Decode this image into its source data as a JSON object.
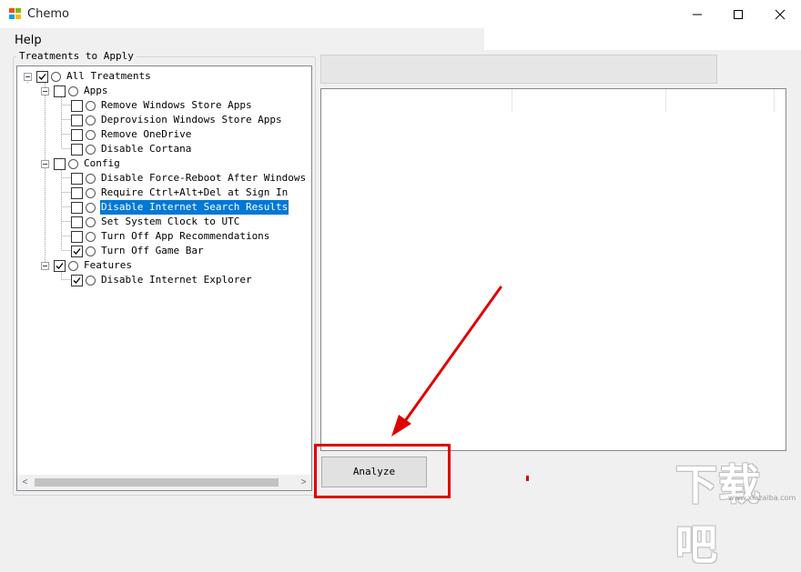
{
  "window": {
    "title": "Chemo",
    "controls": {
      "minimize": "—",
      "maximize": "☐",
      "close": "✕"
    }
  },
  "menu": {
    "help": "Help"
  },
  "treatments": {
    "group_title": "Treatments to Apply",
    "root": {
      "label": "All Treatments",
      "checked": true
    },
    "groups": [
      {
        "label": "Apps",
        "checked": false,
        "items": [
          {
            "label": "Remove Windows Store Apps",
            "checked": false
          },
          {
            "label": "Deprovision Windows Store Apps",
            "checked": false
          },
          {
            "label": "Remove OneDrive",
            "checked": false
          },
          {
            "label": "Disable Cortana",
            "checked": false
          }
        ]
      },
      {
        "label": "Config",
        "checked": false,
        "items": [
          {
            "label": "Disable Force-Reboot After Windows Upd",
            "checked": false
          },
          {
            "label": "Require Ctrl+Alt+Del at Sign In",
            "checked": false
          },
          {
            "label": "Disable Internet Search Results",
            "checked": false,
            "selected": true
          },
          {
            "label": "Set System Clock to UTC",
            "checked": false
          },
          {
            "label": "Turn Off App Recommendations",
            "checked": false
          },
          {
            "label": "Turn Off Game Bar",
            "checked": true
          }
        ]
      },
      {
        "label": "Features",
        "checked": true,
        "items": [
          {
            "label": "Disable Internet Explorer",
            "checked": true
          }
        ]
      }
    ]
  },
  "scrollbar": {
    "left_arrow": "<",
    "right_arrow": ">"
  },
  "actions": {
    "analyze": "Analyze"
  },
  "watermark": {
    "text": "下载吧",
    "sub": "www.xiazaiba.com"
  },
  "colors": {
    "annotation": "#e00000",
    "selection": "#0078d7"
  }
}
